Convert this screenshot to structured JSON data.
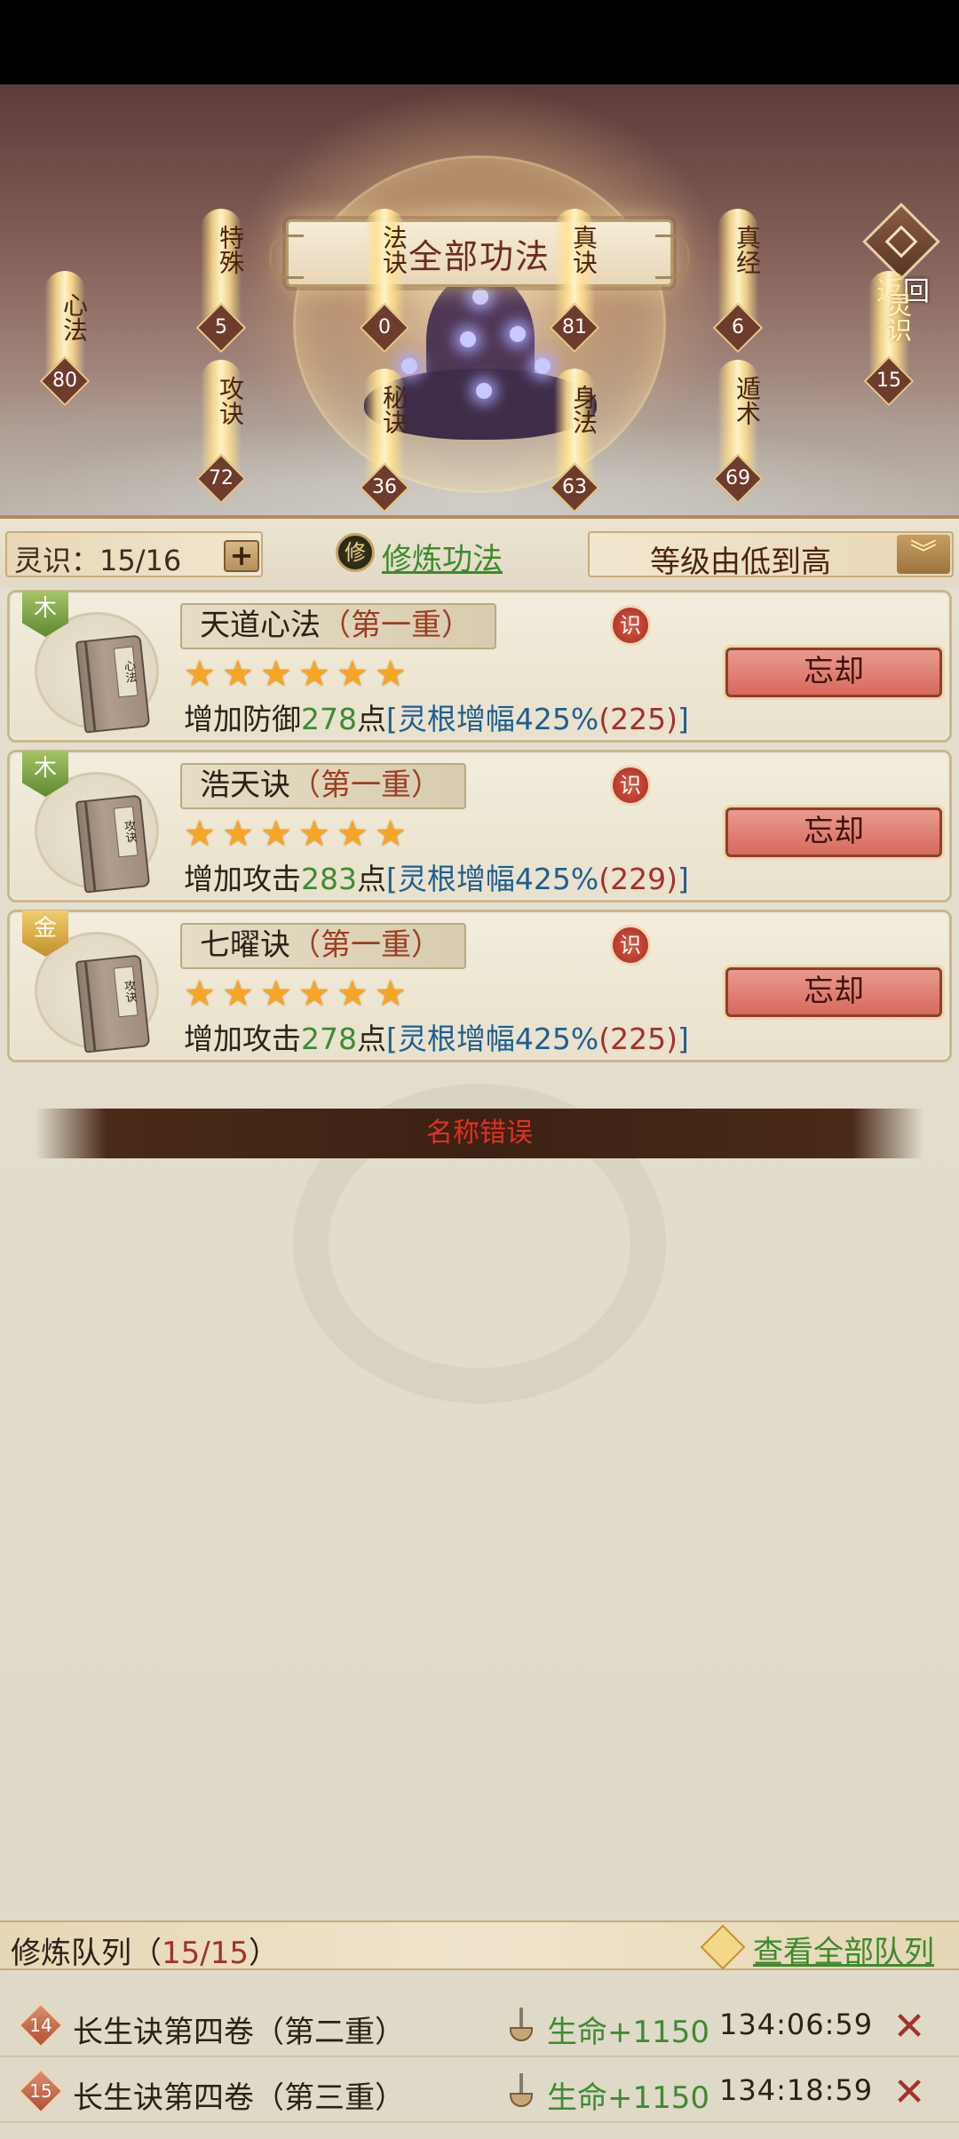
{
  "header": {
    "title": "全部功法",
    "back_label": "返回"
  },
  "categories": [
    {
      "label": "心法",
      "count": "80"
    },
    {
      "label": "特殊",
      "count": "5"
    },
    {
      "label": "攻诀",
      "count": "72"
    },
    {
      "label": "法诀",
      "count": "0"
    },
    {
      "label": "秘诀",
      "count": "36"
    },
    {
      "label": "真诀",
      "count": "81"
    },
    {
      "label": "身法",
      "count": "63"
    },
    {
      "label": "真经",
      "count": "6"
    },
    {
      "label": "遁术",
      "count": "69"
    },
    {
      "label": "灵识",
      "count": "15"
    }
  ],
  "toolbar": {
    "lingshi_label": "灵识：15/16",
    "plus_label": "+",
    "xiu_icon": "修",
    "xiu_link": "修炼功法",
    "sort_value": "等级由低到高",
    "sort_arrow_icon": "chevron-down-icon"
  },
  "skills": [
    {
      "element": "木",
      "element_color": "#5d8a2e",
      "book_label": "心法",
      "name": "天道心法",
      "rank": "（第一重）",
      "shi": "识",
      "stars": 6,
      "desc_pre": "增加防御",
      "desc_num": "278",
      "desc_mid": "点",
      "desc_bracket": "[灵根增幅425%",
      "desc_paren": "(225)",
      "desc_end": "]",
      "action": "忘却"
    },
    {
      "element": "木",
      "element_color": "#5d8a2e",
      "book_label": "攻诀",
      "name": "浩天诀",
      "rank": "（第一重）",
      "shi": "识",
      "stars": 6,
      "desc_pre": "增加攻击",
      "desc_num": "283",
      "desc_mid": "点",
      "desc_bracket": "[灵根增幅425%",
      "desc_paren": "(229)",
      "desc_end": "]",
      "action": "忘却"
    },
    {
      "element": "金",
      "element_color": "#c2912c",
      "book_label": "攻诀",
      "name": "七曜诀",
      "rank": "（第一重）",
      "shi": "识",
      "stars": 6,
      "desc_pre": "增加攻击",
      "desc_num": "278",
      "desc_mid": "点",
      "desc_bracket": "[灵根增幅425%",
      "desc_paren": "(225)",
      "desc_end": "]",
      "action": "忘却"
    }
  ],
  "banner_error": "名称错误",
  "queue": {
    "title_pre": "修炼队列（",
    "count": "15/15",
    "title_post": "）",
    "view_all": "查看全部队列",
    "rows": [
      {
        "index": "14",
        "name": "长生诀第四卷（第二重）",
        "effect": "生命+1150",
        "time": "134:06:59"
      },
      {
        "index": "15",
        "name": "长生诀第四卷（第三重）",
        "effect": "生命+1150",
        "time": "134:18:59"
      }
    ]
  }
}
